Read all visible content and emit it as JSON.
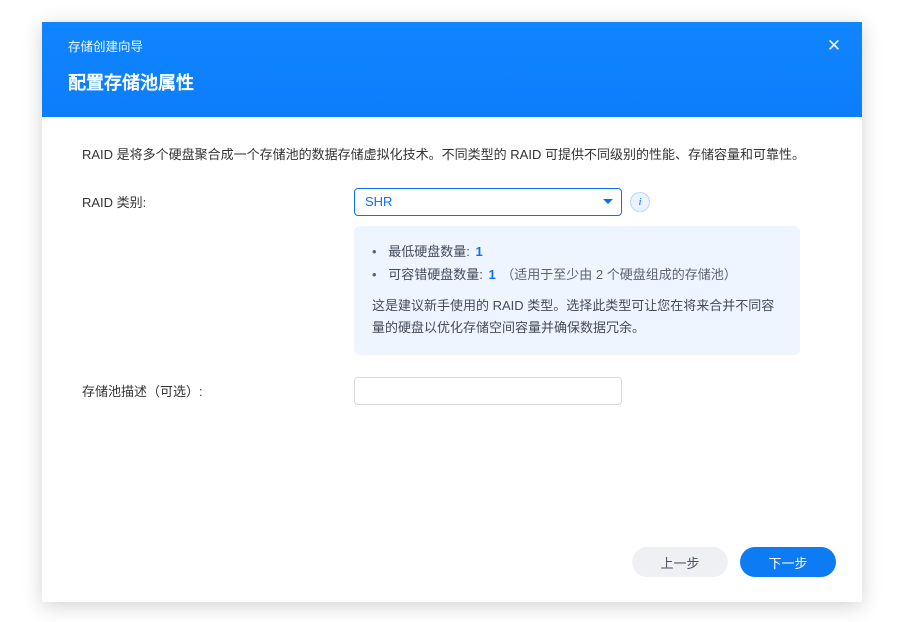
{
  "header": {
    "breadcrumb": "存储创建向导",
    "title": "配置存储池属性"
  },
  "body": {
    "intro": "RAID 是将多个硬盘聚合成一个存储池的数据存储虚拟化技术。不同类型的 RAID 可提供不同级别的性能、存储容量和可靠性。",
    "raid_label": "RAID 类别:",
    "raid_select_value": "SHR",
    "hint": {
      "min_drives_label": "最低硬盘数量:",
      "min_drives_value": "1",
      "fault_label": "可容错硬盘数量:",
      "fault_value": "1",
      "fault_extra": "（适用于至少由 2 个硬盘组成的存储池）",
      "description": "这是建议新手使用的 RAID 类型。选择此类型可让您在将来合并不同容量的硬盘以优化存储空间容量并确保数据冗余。"
    },
    "desc_label": "存储池描述（可选）:",
    "desc_value": ""
  },
  "footer": {
    "prev": "上一步",
    "next": "下一步"
  },
  "info_icon_glyph": "i"
}
